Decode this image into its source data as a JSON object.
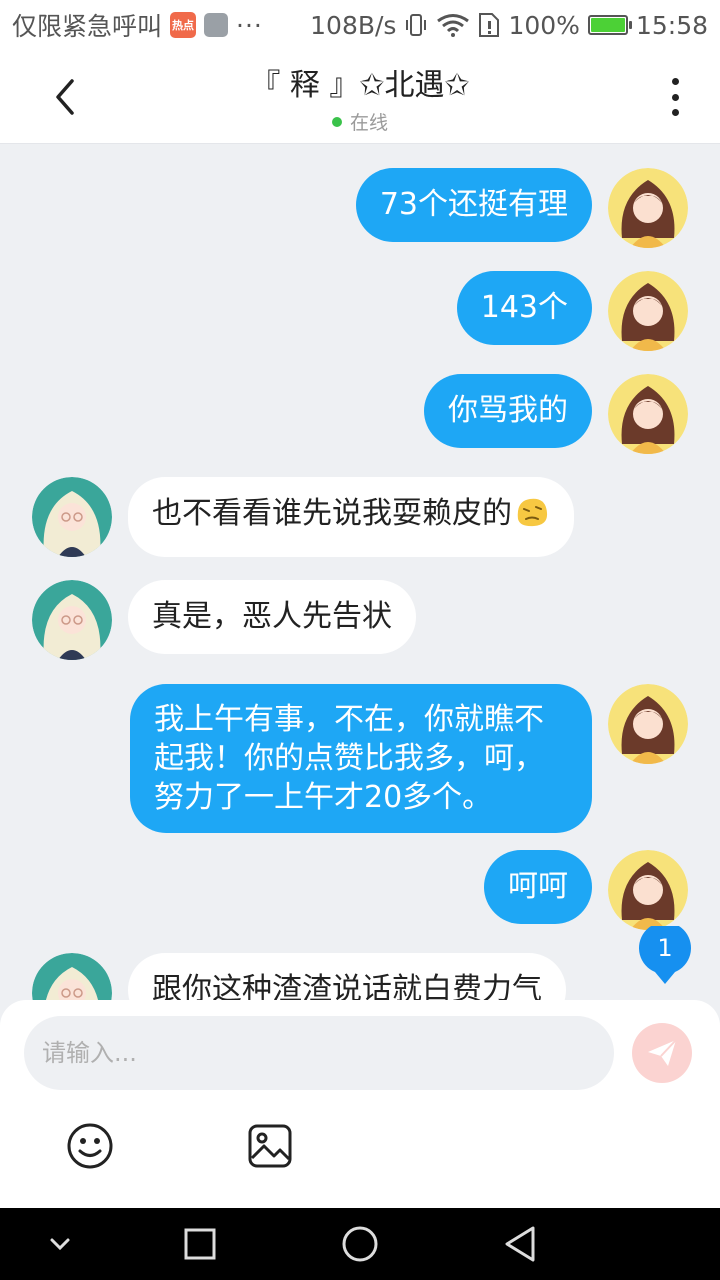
{
  "status_bar": {
    "carrier_text": "仅限紧急呼叫",
    "app_badge": "热点",
    "more": "···",
    "net_speed": "108B/s",
    "battery_percent": "100%",
    "battery_level": 1.0,
    "time": "15:58"
  },
  "header": {
    "title": "『 释 』✩北遇✩",
    "status": "在线",
    "status_color": "#3ac24a"
  },
  "messages": [
    {
      "side": "out",
      "text": "73个还挺有理"
    },
    {
      "side": "out",
      "text": "143个"
    },
    {
      "side": "out",
      "text": "你骂我的"
    },
    {
      "side": "in",
      "text": "也不看看谁先说我耍赖皮的",
      "emoji": "awkward-face-emoji"
    },
    {
      "side": "in",
      "text": "真是，恶人先告状"
    },
    {
      "side": "out",
      "lines": [
        "我上午有事，不在，你就瞧不",
        "起我！你的点赞比我多，呵，",
        "努力了一上午才20多个。"
      ]
    },
    {
      "side": "out",
      "text": "呵呵"
    },
    {
      "side": "in",
      "text": "跟你这种渣渣说话就白费力气"
    }
  ],
  "unread_count": "1",
  "composer": {
    "placeholder": "请输入...",
    "send_icon": "paper-plane-icon",
    "emoji_icon": "smiley-icon",
    "image_icon": "image-icon"
  },
  "colors": {
    "outgoing_bubble": "#1ea7f5",
    "incoming_bubble": "#ffffff",
    "chat_background": "#eef0f3",
    "send_button": "#fbd3d1"
  }
}
